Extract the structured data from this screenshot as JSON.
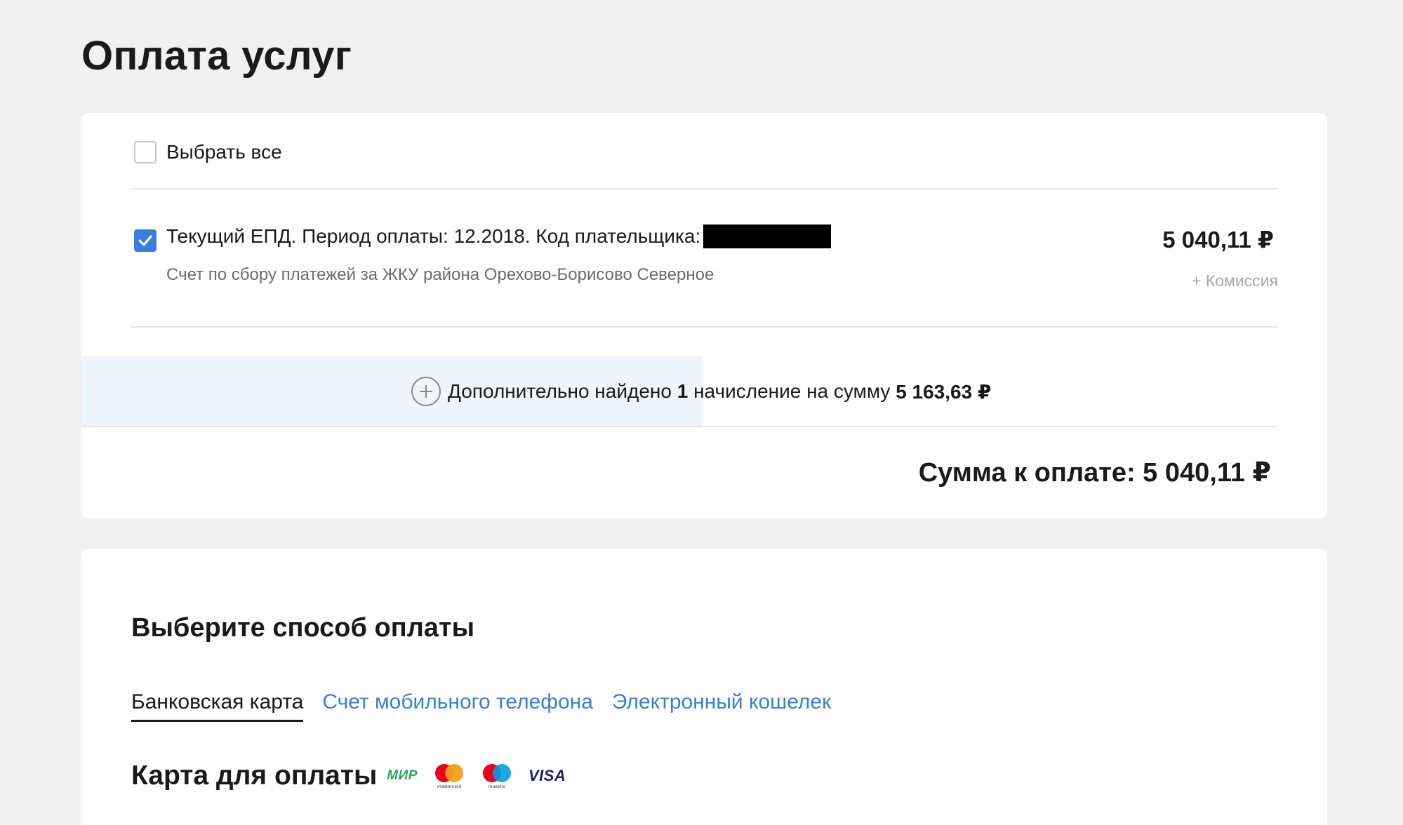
{
  "page": {
    "title": "Оплата услуг"
  },
  "bills": {
    "select_all_label": "Выбрать все",
    "select_all_checked": false,
    "item": {
      "checked": true,
      "title": "Текущий ЕПД. Период оплаты: 12.2018. Код плательщика:",
      "description": "Счет по сбору платежей за ЖКУ района Орехово-Борисово Северное",
      "amount": "5 040,11 ₽",
      "commission": "+ Комиссия"
    },
    "extra": {
      "prefix": "Дополнительно найдено",
      "count": "1",
      "middle": "начисление на сумму",
      "sum": "5 163,63 ₽"
    },
    "total": "Сумма к оплате: 5 040,11 ₽"
  },
  "payment": {
    "section_title": "Выберите способ оплаты",
    "tabs": [
      {
        "label": "Банковская карта",
        "active": true
      },
      {
        "label": "Счет мобильного телефона",
        "active": false
      },
      {
        "label": "Электронный кошелек",
        "active": false
      }
    ],
    "card_heading": "Карта для оплаты",
    "brands": {
      "mir": "МИР",
      "mastercard": "mastercard",
      "maestro": "maestro",
      "visa": "VISA"
    },
    "colors": {
      "accent": "#3b7ddd",
      "mir_green": "#2aa65a",
      "mastercard_red": "#eb001b",
      "mastercard_orange": "#f79e1b",
      "maestro_red": "#eb001b",
      "maestro_blue": "#00a1df",
      "visa_blue": "#1a1f71"
    }
  }
}
